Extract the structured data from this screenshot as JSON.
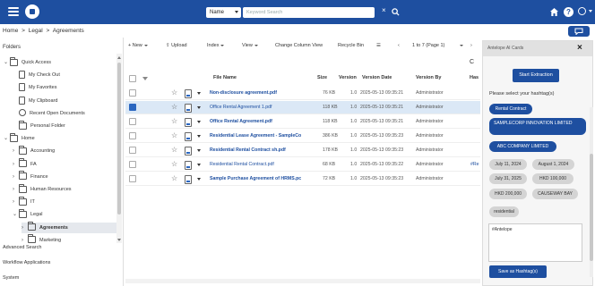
{
  "topbar": {
    "search_scope": "Name",
    "search_placeholder": "Keyword Search",
    "clear_icon": "×",
    "search_icon": "search-icon",
    "home_icon": "home-icon",
    "help_label": "?",
    "user_icon": "user-icon",
    "brand_color": "#1e4fa0"
  },
  "breadcrumb": [
    "Home",
    ">",
    "Legal",
    ">",
    "Agreements"
  ],
  "left": {
    "title": "Folders",
    "tree": [
      {
        "label": "Quick Access",
        "chev": "⌄",
        "icon": "folder"
      },
      {
        "label": "My Check Out",
        "chev": "",
        "icon": "doc"
      },
      {
        "label": "My Favorites",
        "chev": "",
        "icon": "doc"
      },
      {
        "label": "My Clipboard",
        "chev": "",
        "icon": "doc"
      },
      {
        "label": "Recent Open Documents",
        "chev": "",
        "icon": "clock"
      },
      {
        "label": "Personal Folder",
        "chev": "",
        "icon": "folder"
      },
      {
        "label": "Home",
        "chev": "⌄",
        "icon": "folder"
      },
      {
        "label": "Accounting",
        "chev": "›",
        "icon": "folder"
      },
      {
        "label": "FA",
        "chev": "›",
        "icon": "folder"
      },
      {
        "label": "Finance",
        "chev": "›",
        "icon": "folder"
      },
      {
        "label": "Human Resources",
        "chev": "›",
        "icon": "folder"
      },
      {
        "label": "IT",
        "chev": "›",
        "icon": "folder"
      },
      {
        "label": "Legal",
        "chev": "⌄",
        "icon": "folder"
      },
      {
        "label": "Agreements",
        "chev": "›",
        "icon": "folder"
      },
      {
        "label": "Marketing",
        "chev": "›",
        "icon": "folder"
      }
    ],
    "bottom_links": [
      "Advanced Search",
      "Workflow Applications",
      "System"
    ]
  },
  "toolbar": {
    "new_label": "+ New",
    "upload_label": "Upload",
    "index_label": "Index",
    "view_label": "View",
    "change_column_label": "Change Column View",
    "recycle_label": "Recycle Bin",
    "list_icon": "☰",
    "prev_label": "‹",
    "page_label": "1 to 7 (Page 1)",
    "next_label": "›",
    "refresh_icon": "C"
  },
  "table": {
    "headers": {
      "file_name": "File Name",
      "size": "Size",
      "version": "Version",
      "version_date": "Version Date",
      "version_by": "Version By",
      "extra": "Has"
    },
    "rows": [
      {
        "name": "Non-disclosure agreement.pdf",
        "size": "76 KB",
        "version": "1.0",
        "date": "2025-05-13 09:35:21",
        "by": "Administrator",
        "extra": "",
        "bold": true,
        "checked": false
      },
      {
        "name": "Office Rental Agreement 1.pdf",
        "size": "118 KB",
        "version": "1.0",
        "date": "2025-05-13 09:35:21",
        "by": "Administrator",
        "extra": "",
        "bold": false,
        "checked": true
      },
      {
        "name": "Office Rental Agreement.pdf",
        "size": "118 KB",
        "version": "1.0",
        "date": "2025-05-13 09:35:21",
        "by": "Administrator",
        "extra": "",
        "bold": true,
        "checked": false
      },
      {
        "name": "Residential Lease Agreement - SampleCo",
        "size": "386 KB",
        "version": "1.0",
        "date": "2025-05-13 09:35:23",
        "by": "Administrator",
        "extra": "",
        "bold": true,
        "checked": false
      },
      {
        "name": "Residential Rental Contract sh.pdf",
        "size": "178 KB",
        "version": "1.0",
        "date": "2025-05-13 09:35:23",
        "by": "Administrator",
        "extra": "",
        "bold": true,
        "checked": false
      },
      {
        "name": "Residential Rental Contract.pdf",
        "size": "68 KB",
        "version": "1.0",
        "date": "2025-05-13 09:35:22",
        "by": "Administrator",
        "extra": "#Re",
        "bold": false,
        "checked": false
      },
      {
        "name": "Sample Purchase Agreement of HRMS.pc",
        "size": "72 KB",
        "version": "1.0",
        "date": "2025-05-13 09:35:23",
        "by": "Administrator",
        "extra": "",
        "bold": true,
        "checked": false
      }
    ]
  },
  "ai": {
    "title": "Antelope AI Cards",
    "close": "×",
    "start_label": "Start Extraction",
    "select_label": "Please select your hashtag(s)",
    "tags": [
      {
        "label": "Rental Contract",
        "on": true
      },
      {
        "label": "SAMPLECORP INNOVATION LIMITED",
        "on": true
      },
      {
        "label": "ABC COMPANY LIMITED",
        "on": true
      },
      {
        "label": "July 11, 2024",
        "on": false
      },
      {
        "label": "August 1, 2024",
        "on": false
      },
      {
        "label": "July 31, 2025",
        "on": false
      },
      {
        "label": "HKD 100,000",
        "on": false
      },
      {
        "label": "HKD 200,000",
        "on": false
      },
      {
        "label": "CAUSEWAY BAY",
        "on": false
      },
      {
        "label": "residential",
        "on": false
      }
    ],
    "hashtag_value": "#Antelope",
    "save_label": "Save as Hashtag(s)"
  }
}
